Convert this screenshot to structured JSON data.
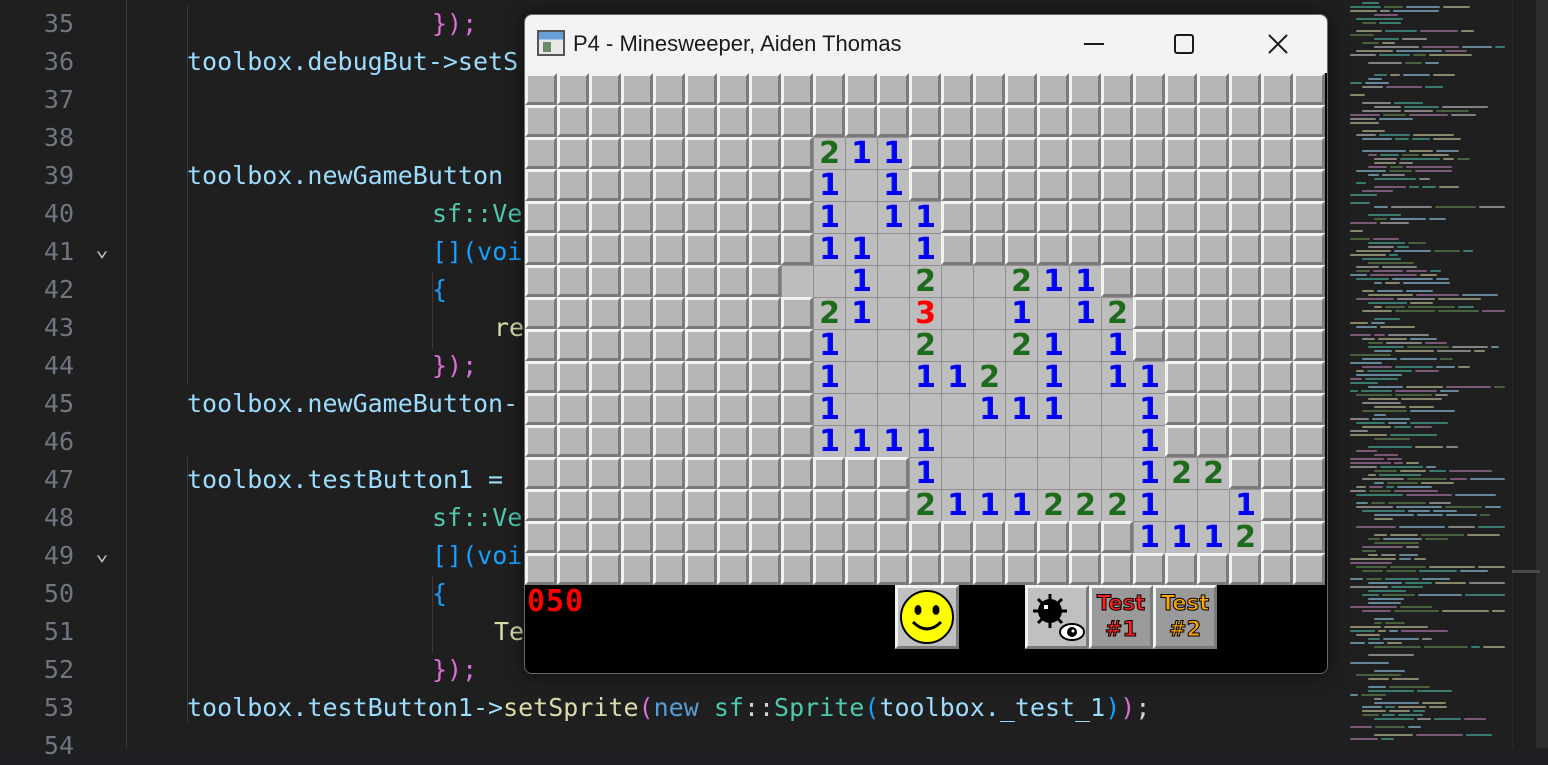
{
  "editor": {
    "line_numbers": [
      "35",
      "36",
      "37",
      "38",
      "39",
      "40",
      "41",
      "42",
      "43",
      "44",
      "45",
      "46",
      "47",
      "48",
      "49",
      "50",
      "51",
      "52",
      "53",
      "54"
    ],
    "folds": {
      "41": "⌄",
      "49": "⌄"
    },
    "lines": {
      "35": [
        {
          "t": "});",
          "c": "t-br1"
        }
      ],
      "36": [
        {
          "t": "toolbox.debugBut->setS",
          "c": "t-var"
        }
      ],
      "39": [
        {
          "t": "toolbox.newGameButton",
          "c": "t-var"
        }
      ],
      "40": [
        {
          "t": "sf::Ve",
          "c": "t-ns"
        }
      ],
      "41": [
        {
          "t": "[](voi",
          "c": "t-br2"
        }
      ],
      "42": [
        {
          "t": "{",
          "c": "t-br2"
        }
      ],
      "43": [
        {
          "t": "re",
          "c": "t-fn"
        }
      ],
      "44": [
        {
          "t": "});",
          "c": "t-br1"
        }
      ],
      "45": [
        {
          "t": "toolbox.newGameButton-",
          "c": "t-var"
        }
      ],
      "47": [
        {
          "t": "toolbox.testButton1 =",
          "c": "t-var"
        }
      ],
      "48": [
        {
          "t": "sf::Ve",
          "c": "t-ns"
        }
      ],
      "49": [
        {
          "t": "[](voi",
          "c": "t-br2"
        }
      ],
      "50": [
        {
          "t": "{",
          "c": "t-br2"
        }
      ],
      "51": [
        {
          "t": "Te",
          "c": "t-fn"
        }
      ],
      "52": [
        {
          "t": "});",
          "c": "t-br1"
        }
      ],
      "53": [
        {
          "t": "toolbox.testButton1->",
          "c": "t-var"
        },
        {
          "t": "setSprite",
          "c": "t-fn"
        },
        {
          "t": "(",
          "c": "t-br1"
        },
        {
          "t": "new ",
          "c": "t-kw"
        },
        {
          "t": "sf",
          "c": "t-ns"
        },
        {
          "t": "::",
          "c": "t-op"
        },
        {
          "t": "Sprite",
          "c": "t-ns"
        },
        {
          "t": "(",
          "c": "t-br2"
        },
        {
          "t": "toolbox._test_1",
          "c": "t-var"
        },
        {
          "t": ")",
          "c": "t-br2"
        },
        {
          "t": ")",
          "c": "t-br1"
        },
        {
          "t": ";",
          "c": "t-op"
        }
      ]
    }
  },
  "game_window": {
    "title": "P4 - Minesweeper, Aiden Thomas",
    "mine_counter": "050",
    "test1_label": [
      "Test",
      "#1"
    ],
    "test2_label": [
      "Test",
      "#2"
    ],
    "board": [
      "#########################",
      "#########################",
      "#########211#############",
      "#########1 1#############",
      "#########1 11############",
      "#########11 1############",
      "########  1 2  211#######",
      "#########21 3  1 12######",
      "#########1  2  21 1######",
      "#########1  112 1 11#####",
      "#########1    111  1#####",
      "#########1111      1#####",
      "############1      122###",
      "############21112221  1##",
      "###################1112##",
      "#########################"
    ]
  },
  "colors": {
    "editor_bg": "#1f1f1f",
    "number_1": "#0000ff",
    "number_2": "#1e6b1e",
    "number_3": "#ff0000",
    "counter": "#ff0000",
    "test1_text": "#ff2020",
    "test2_text": "#ffa500"
  }
}
